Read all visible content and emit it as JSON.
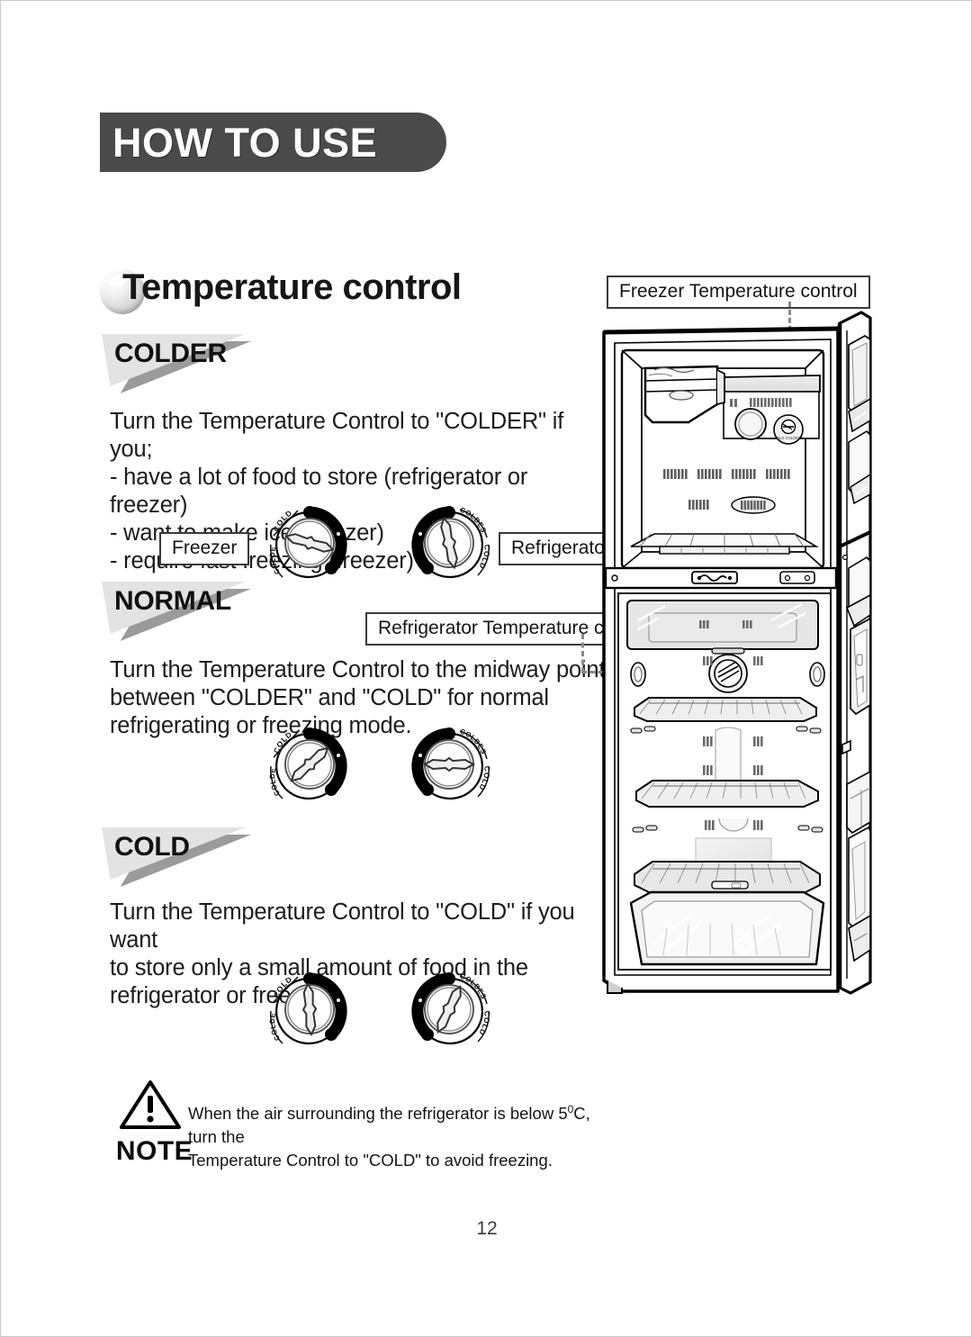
{
  "page": {
    "banner_title": "HOW TO USE",
    "section_title": "Temperature control",
    "page_number": "12"
  },
  "sections": [
    {
      "tag": "COLDER",
      "body": "Turn the Temperature Control to \"COLDER\" if you;\n- have a lot of food to store (refrigerator or freezer)\n- want to make ice (freezer)\n- require fast freezing (freezer)",
      "freezer_label": "Freezer",
      "refrigerator_label": "Refrigerator"
    },
    {
      "tag": "NORMAL",
      "body": "Turn the Temperature Control to the midway point\nbetween \"COLDER\" and \"COLD\" for normal\nrefrigerating or freezing mode."
    },
    {
      "tag": "COLD",
      "body": "Turn the Temperature Control to \"COLD\" if you want\nto store only a small amount of food in the\nrefrigerator or freezer."
    }
  ],
  "dial_labels": {
    "cold": "COLD",
    "coldest": "COLDEST"
  },
  "callouts": {
    "freezer_temperature_control": "Freezer Temperature control",
    "refrigerator_temperature_control": "Refrigerator Temperature control"
  },
  "note": {
    "heading": "NOTE",
    "line1_a": "When the air surrounding the refrigerator is below 5",
    "line1_deg": "0",
    "line1_b": "C, turn the",
    "line2": "Temperature Control to \"COLD\" to avoid freezing."
  },
  "colors": {
    "banner_bg": "#4a4a4a",
    "tag_bg": "#e3e3e3",
    "tag_shadow": "#9b9b9b",
    "dial_arc": "#000000",
    "dash_line": "#8d8a88",
    "page_border": "#c9c9c9"
  }
}
